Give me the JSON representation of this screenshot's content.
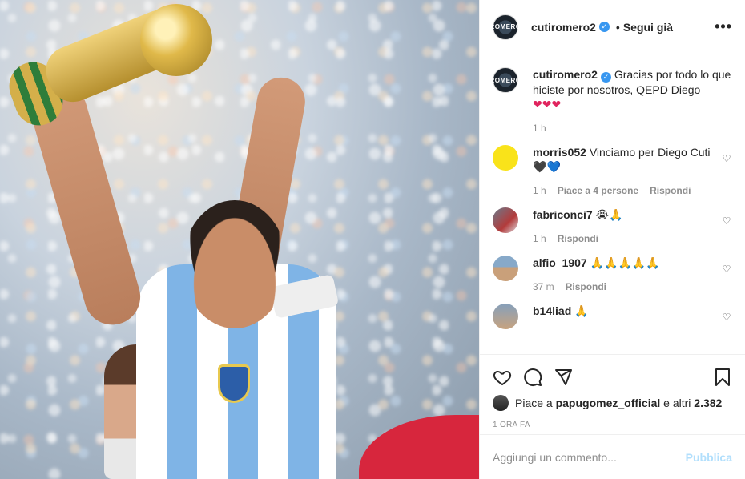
{
  "post": {
    "author": {
      "username": "cutiromero2",
      "verified": true,
      "avatar_text": "ROMERO"
    },
    "follow_separator": "•",
    "follow_label": "Segui già",
    "more_label": "•••"
  },
  "caption": {
    "username": "cutiromero2",
    "text": "Gracias por todo lo que hiciste por nosotros, QEPD Diego",
    "emojis": "❤❤❤",
    "time": "1 h"
  },
  "comments": [
    {
      "username": "morris052",
      "text": "Vinciamo per Diego Cuti",
      "emojis": [
        "🖤",
        "💙"
      ],
      "time": "1 h",
      "likes_label": "Piace a 4 persone",
      "reply_label": "Rispondi"
    },
    {
      "username": "fabriconci7",
      "text": "😭🙏",
      "time": "1 h",
      "reply_label": "Rispondi"
    },
    {
      "username": "alfio_1907",
      "text": "🙏🙏🙏🙏🙏",
      "time": "37 m",
      "reply_label": "Rispondi"
    },
    {
      "username": "b14liad",
      "text": "🙏"
    }
  ],
  "likes": {
    "prefix": "Piace a",
    "user": "papugomez_official",
    "middle": "e altri",
    "count": "2.382"
  },
  "timestamp": "1 ORA FA",
  "add_comment": {
    "placeholder": "Aggiungi un commento...",
    "publish_label": "Pubblica"
  },
  "colors": {
    "verified": "#3897f0",
    "publish_disabled": "#b2dffc",
    "muted_text": "#8e8e8e"
  }
}
